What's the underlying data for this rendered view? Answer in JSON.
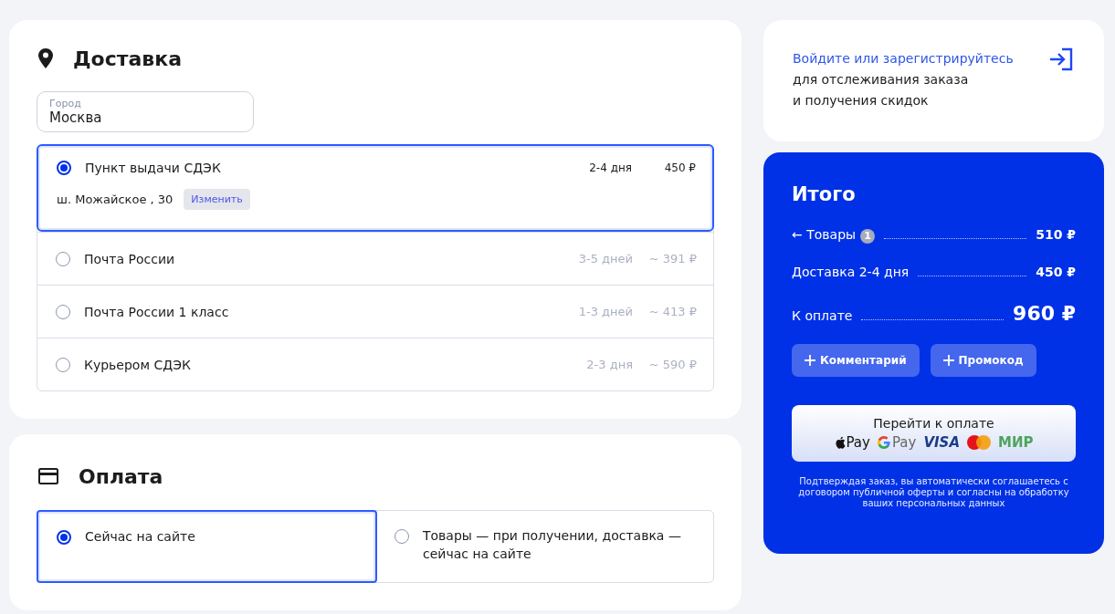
{
  "delivery": {
    "title": "Доставка",
    "city": {
      "label": "Город",
      "value": "Москва"
    },
    "options": [
      {
        "name": "Пункт выдачи СДЭК",
        "selected": true,
        "term": "2-4 дня",
        "price": "450 ₽",
        "address": "ш. Можайское , 30",
        "change": "Изменить"
      },
      {
        "name": "Почта России",
        "selected": false,
        "term": "3-5 дней",
        "price": "~ 391 ₽"
      },
      {
        "name": "Почта России 1 класс",
        "selected": false,
        "term": "1-3 дней",
        "price": "~ 413 ₽"
      },
      {
        "name": "Курьером СДЭК",
        "selected": false,
        "term": "2-3 дня",
        "price": "~ 590 ₽"
      }
    ]
  },
  "payment": {
    "title": "Оплата",
    "options": [
      {
        "name": "Сейчас на сайте",
        "selected": true
      },
      {
        "name": "Товары — при получении, доставка — сейчас на сайте",
        "selected": false
      }
    ]
  },
  "login": {
    "link": "Войдите или зарегистрируйтесь",
    "text_lines": [
      "для отслеживания заказа",
      "и получения скидок"
    ]
  },
  "total": {
    "title": "Итого",
    "rows": [
      {
        "kind": "goods",
        "label": "← Товары",
        "badge": "1",
        "value": "510 ₽"
      },
      {
        "kind": "line",
        "label": "Доставка 2-4 дня",
        "value": "450 ₽"
      },
      {
        "kind": "grand",
        "label": "К оплате",
        "value": "960 ₽"
      }
    ],
    "buttons": [
      "Комментарий",
      "Промокод"
    ],
    "pay_button": {
      "label": "Перейти к оплате",
      "methods": [
        {
          "kind": "apple",
          "text": "Pay"
        },
        {
          "kind": "google",
          "text": "Pay"
        },
        {
          "kind": "visa",
          "text": "VISA"
        },
        {
          "kind": "mastercard"
        },
        {
          "kind": "mir",
          "text": "МИР"
        }
      ]
    },
    "note": "Подтверждая заказ, вы автоматически соглашаетесь с договором публичной оферты и согласны на обработку ваших персональных данных"
  }
}
